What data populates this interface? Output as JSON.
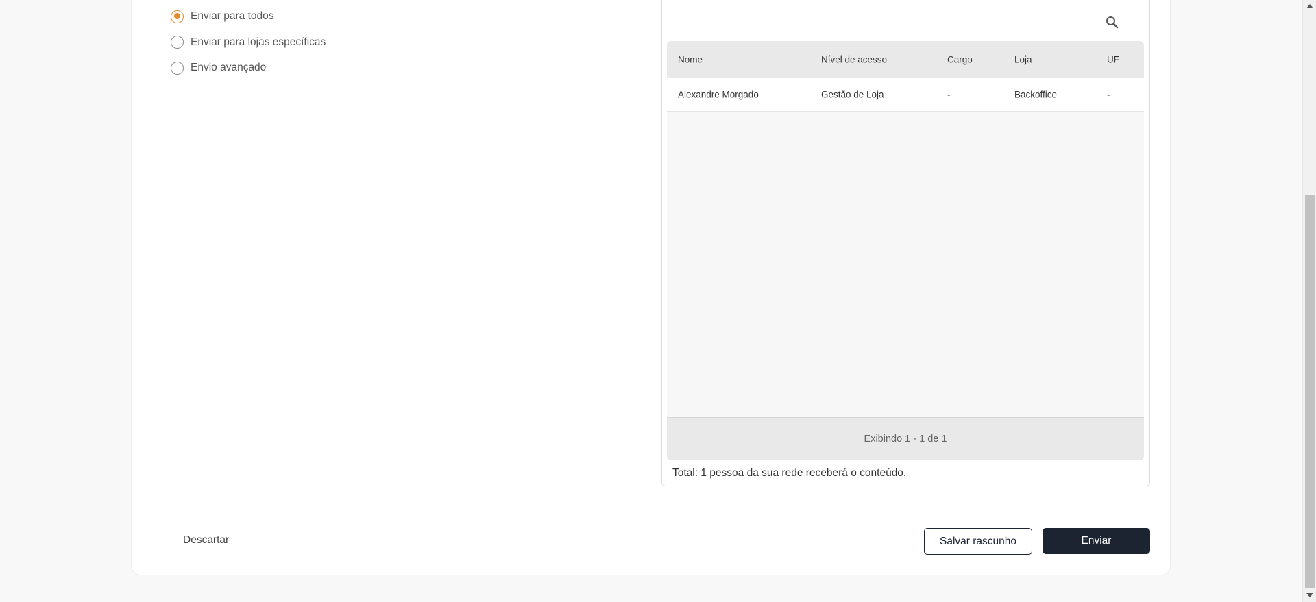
{
  "audience": {
    "options": [
      {
        "label": "Enviar para todos",
        "selected": true
      },
      {
        "label": "Enviar para lojas específicas",
        "selected": false
      },
      {
        "label": "Envio avançado",
        "selected": false
      }
    ]
  },
  "recipients": {
    "search_icon": "search-icon",
    "columns": {
      "name": "Nome",
      "access": "Nível de acesso",
      "role": "Cargo",
      "store": "Loja",
      "state": "UF"
    },
    "rows": [
      {
        "name": "Alexandre Morgado",
        "access": "Gestão de Loja",
        "role": "-",
        "store": "Backoffice",
        "state": "-"
      }
    ],
    "pagination": "Exibindo 1 - 1 de 1",
    "total": "Total: 1 pessoa da sua rede receberá o conteúdo."
  },
  "actions": {
    "discard": "Descartar",
    "save_draft": "Salvar rascunho",
    "send": "Enviar"
  },
  "colors": {
    "accent": "#e8892a",
    "primary": "#1c2331"
  }
}
